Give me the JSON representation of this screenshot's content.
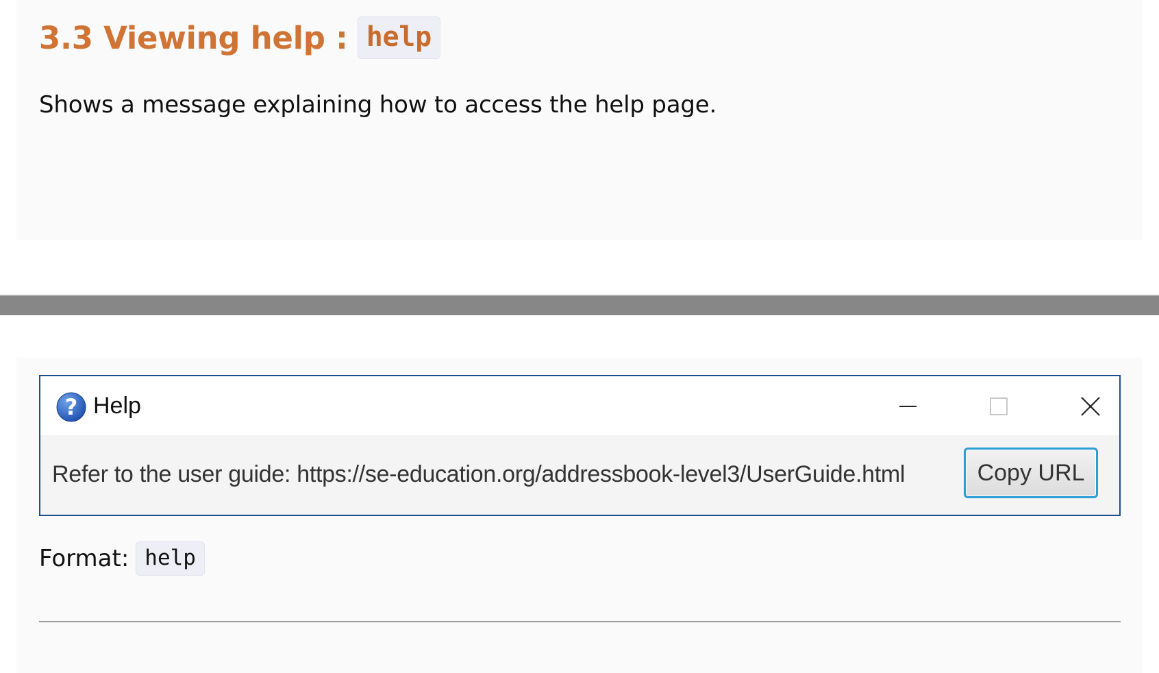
{
  "section": {
    "heading_text": "3.3 Viewing help :",
    "heading_code": "help",
    "description": "Shows a message explaining how to access the help page."
  },
  "help_window": {
    "title": "Help",
    "message": "Refer to the user guide: https://se-education.org/addressbook-level3/UserGuide.html",
    "copy_button_label": "Copy URL",
    "icons": {
      "app_icon": "help-question-icon",
      "minimize": "minimize-icon",
      "maximize": "maximize-icon",
      "close": "close-icon"
    }
  },
  "format": {
    "label": "Format:",
    "code": "help"
  },
  "colors": {
    "heading": "#d07436",
    "code_chip_bg": "#eeeef6",
    "window_border": "#1c4f8c",
    "button_focus": "#2c9ed6",
    "separator": "#878787"
  }
}
